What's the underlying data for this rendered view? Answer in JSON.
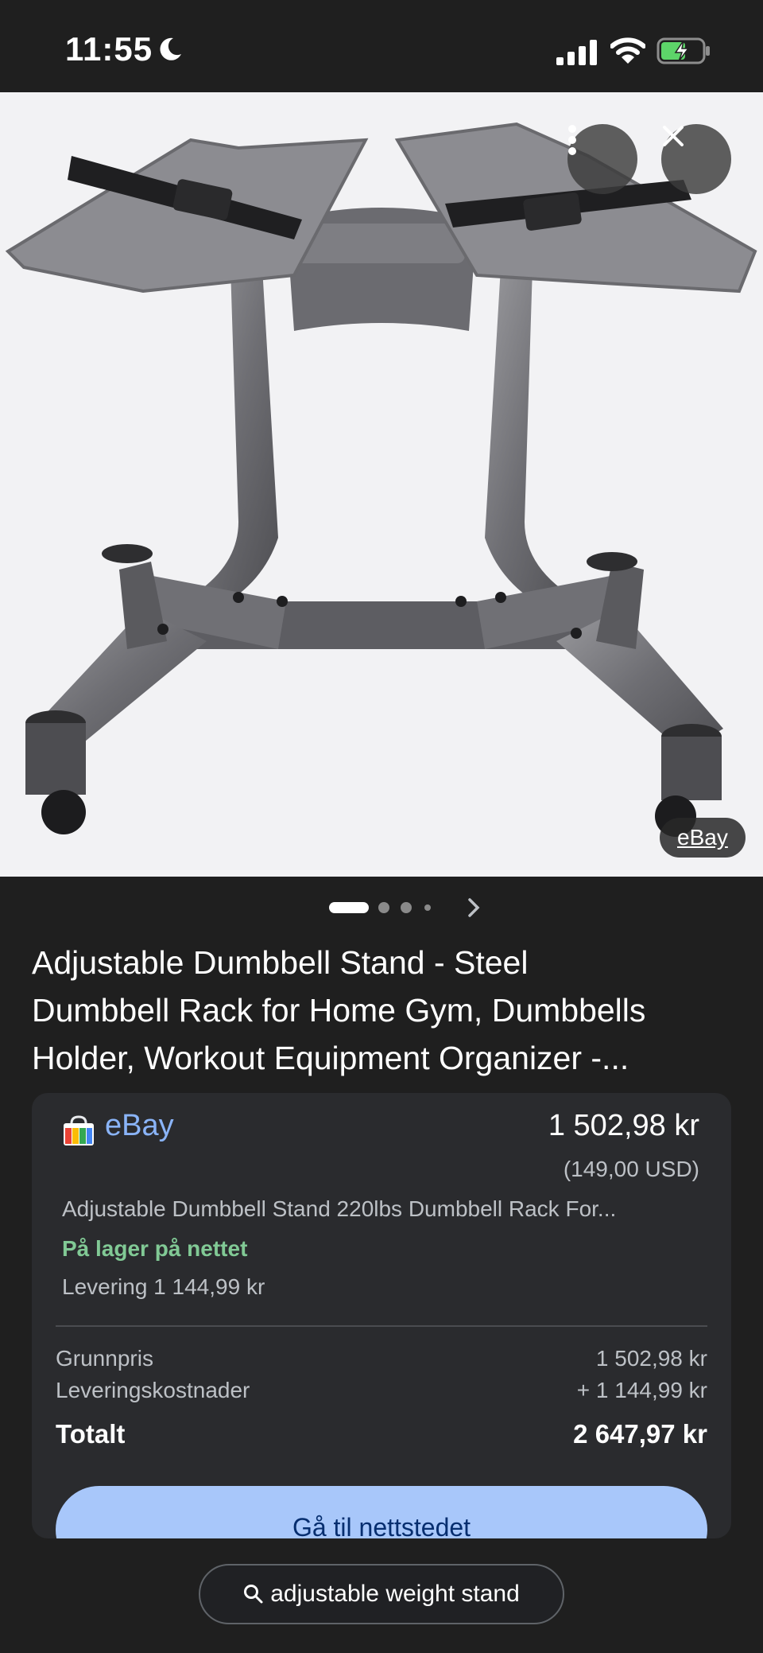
{
  "status_bar": {
    "time": "11:55"
  },
  "hero": {
    "source_label": "eBay"
  },
  "title": {
    "line1": "Adjustable Dumbbell Stand - Steel",
    "line2": "Dumbbell Rack for Home Gym, Dumbbells",
    "line3": "Holder, Workout Equipment Organizer -..."
  },
  "offer": {
    "store": "eBay",
    "price": "1 502,98 kr",
    "price_usd": "(149,00 USD)",
    "description": "Adjustable Dumbbell Stand 220lbs Dumbbell Rack For...",
    "stock": "På lager på nettet",
    "delivery": "Levering 1 144,99 kr",
    "base_label": "Grunnpris",
    "base_value": "1 502,98 kr",
    "shipping_label": "Leveringskostnader",
    "shipping_value": "+ 1 144,99 kr",
    "total_label": "Totalt",
    "total_value": "2 647,97 kr",
    "cta_label": "Gå til nettstedet"
  },
  "bottom": {
    "search_query": "adjustable weight stand"
  },
  "colors": {
    "store_link": "#8ab4f8",
    "stock": "#81c995",
    "cta_bg": "#a8c7fa"
  }
}
